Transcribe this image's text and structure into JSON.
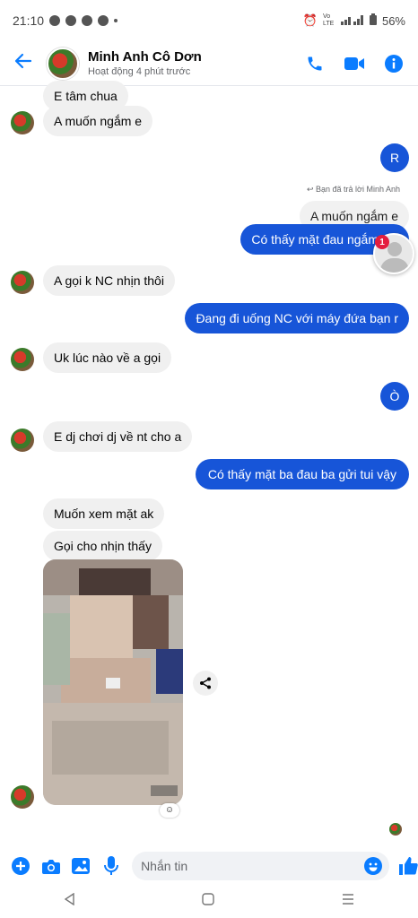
{
  "status": {
    "time": "21:10",
    "battery": "56%",
    "network": "Vo LTE"
  },
  "header": {
    "name": "Minh Anh Cô Dơn",
    "presence": "Hoạt động 4 phút trước"
  },
  "messages": {
    "m1": "E tâm chua",
    "m2": "A muốn ngắm e",
    "m3": "R",
    "reply_note": "Bạn đã trả lời Minh Anh",
    "quoted": "A muốn ngắm e",
    "m4": "Có thấy mặt đau ngắm",
    "m5": "A gọi k NC nhịn thôi",
    "m6": "Đang đi uống NC với máy đứa bạn r",
    "m7": "Uk lúc nào về a gọi",
    "m8": "Ò",
    "m9": "E dj chơi dj về nt cho a",
    "m10": "Có thấy mặt ba đau ba gửi tui vậy",
    "m11": "Muốn xem mặt ak",
    "m12": "Gọi cho nhịn thấy"
  },
  "float_badge": "1",
  "composer": {
    "placeholder": "Nhắn tin"
  },
  "colors": {
    "accent": "#0a7cff",
    "outgoing": "#1755d8",
    "incoming": "#f0f0f0"
  }
}
